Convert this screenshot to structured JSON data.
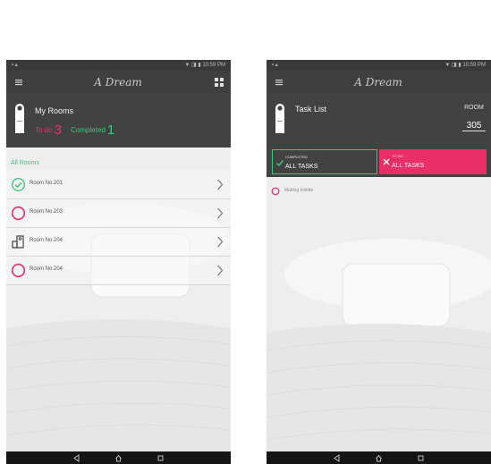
{
  "colors": {
    "accent_pink": "#ea2e66",
    "accent_green": "#3ec67d",
    "header_dark": "#424242",
    "appbar_dark": "#3f3f3f"
  },
  "left_screen": {
    "status": {
      "left": "▪ ▴",
      "right": "▼ ◨ ▮ 10:59 PM"
    },
    "logo": "A Dream",
    "header": {
      "title": "My Rooms",
      "todo_label": "To do",
      "todo_count": "3",
      "completed_label": "Completed",
      "completed_count": "1"
    },
    "section_label": "All Rooms",
    "rooms": [
      {
        "label": "Room No.201",
        "icon": "check-circle-icon"
      },
      {
        "label": "Room No.203",
        "icon": "circle-icon"
      },
      {
        "label": "Room No.204",
        "icon": "door-hanger-icon"
      },
      {
        "label": "Room No.204",
        "icon": "circle-icon"
      }
    ]
  },
  "right_screen": {
    "status": {
      "left": "▪ ▴",
      "right": "▼ ◨ ▮ 10:59 PM"
    },
    "logo": "A Dream",
    "header": {
      "title": "Task List",
      "room_label": "ROOM",
      "room_number": "305"
    },
    "toggle_completed": {
      "small": "COMPLETED",
      "label": "ALL TASKS"
    },
    "toggle_todo": {
      "small": "TO DO",
      "label": "ALL TASKS"
    },
    "tasks": [
      {
        "label": "Making toilette"
      }
    ]
  },
  "navbar": {
    "icons": [
      "back-icon",
      "home-icon",
      "recents-icon"
    ]
  }
}
